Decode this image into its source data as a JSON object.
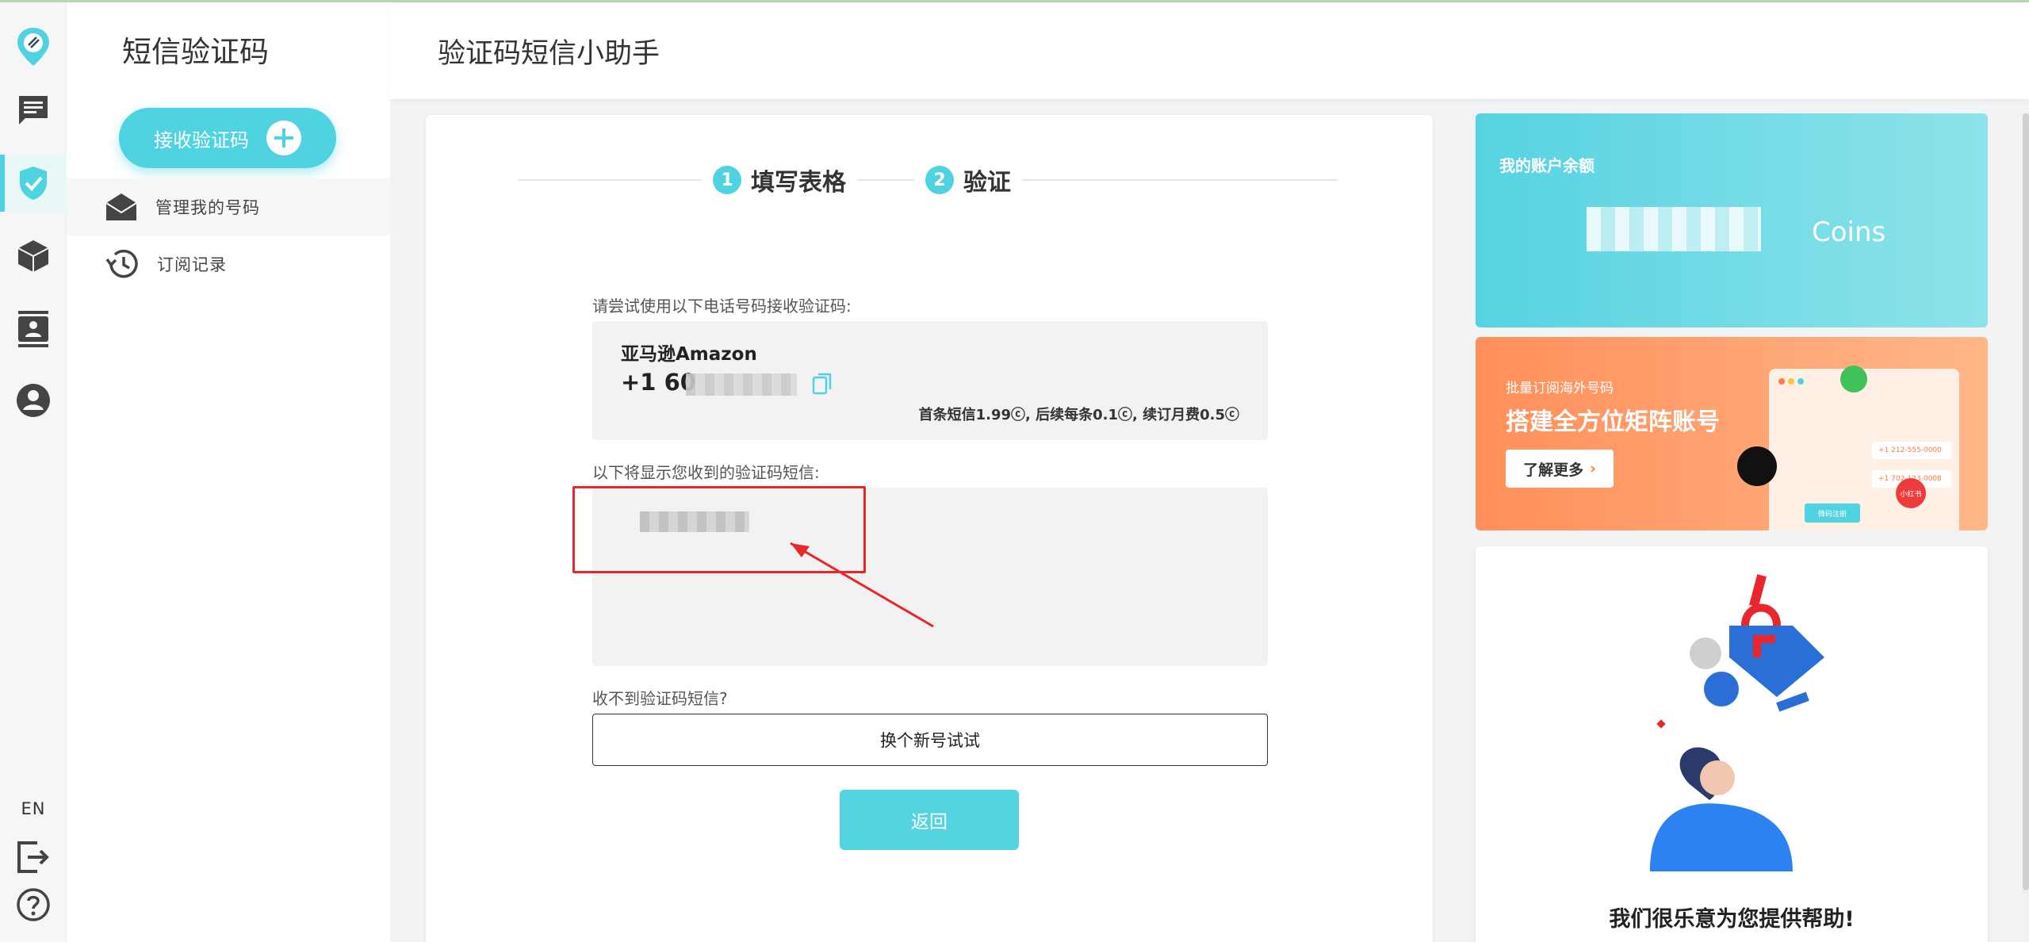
{
  "sidebar": {
    "title": "短信验证码",
    "receive_button": "接收验证码",
    "items": [
      {
        "label": "管理我的号码",
        "icon": "envelope-open-icon"
      },
      {
        "label": "订阅记录",
        "icon": "history-icon"
      }
    ]
  },
  "rail": {
    "language": "EN",
    "icons": [
      "app-logo-icon",
      "chat-icon",
      "shield-check-icon",
      "package-icon",
      "contacts-icon",
      "account-icon",
      "logout-icon",
      "help-icon"
    ]
  },
  "header": {
    "title": "验证码短信小助手"
  },
  "steps": [
    {
      "number": "1",
      "label": "填写表格"
    },
    {
      "number": "2",
      "label": "验证"
    }
  ],
  "form": {
    "number_label": "请尝试使用以下电话号码接收验证码:",
    "service": "亚马逊Amazon",
    "phone_prefix": "+1 60",
    "price_note": "首条短信1.99ⓒ, 后续每条0.1ⓒ, 续订月费0.5ⓒ",
    "messages_label": "以下将显示您收到的验证码短信:",
    "no_code_label": "收不到验证码短信?",
    "new_number_button": "换个新号试试",
    "back_button": "返回"
  },
  "balance": {
    "title": "我的账户余额",
    "unit": "Coins"
  },
  "promo": {
    "subtitle": "批量订阅海外号码",
    "title": "搭建全方位矩阵账号",
    "button": "了解更多",
    "mock_rows": [
      "+1 212-555-0000",
      "+1 702-123-0008"
    ],
    "mock_button": "微码注册",
    "xhs_badge": "小红书"
  },
  "help": {
    "title": "我们很乐意为您提供帮助!"
  },
  "colors": {
    "accent": "#4fd3e0",
    "highlight": "#e8262b",
    "promo": "#ff8f5a"
  }
}
